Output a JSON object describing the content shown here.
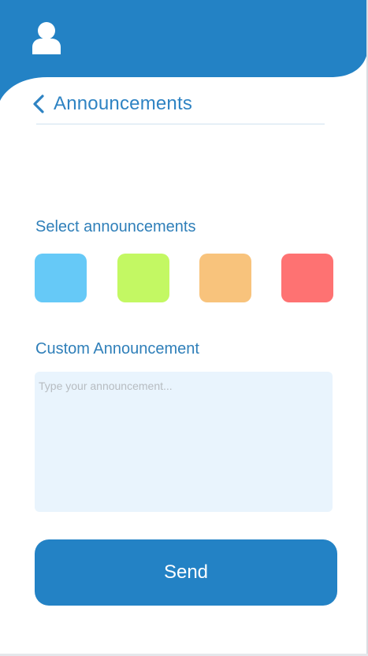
{
  "header": {
    "avatar_icon": "user-icon",
    "back_icon": "chevron-left-icon",
    "title": "Announcements",
    "accent_color": "#2382c5"
  },
  "select_section": {
    "label": "Select announcements",
    "colors": [
      {
        "name": "blue",
        "color": "#66c9f7"
      },
      {
        "name": "green",
        "color": "#c3f863"
      },
      {
        "name": "orange",
        "color": "#f8c37c"
      },
      {
        "name": "red",
        "color": "#fe7272"
      }
    ]
  },
  "custom_section": {
    "label": "Custom Announcement",
    "placeholder": "Type your announcement...",
    "value": ""
  },
  "send_button": {
    "label": "Send"
  }
}
